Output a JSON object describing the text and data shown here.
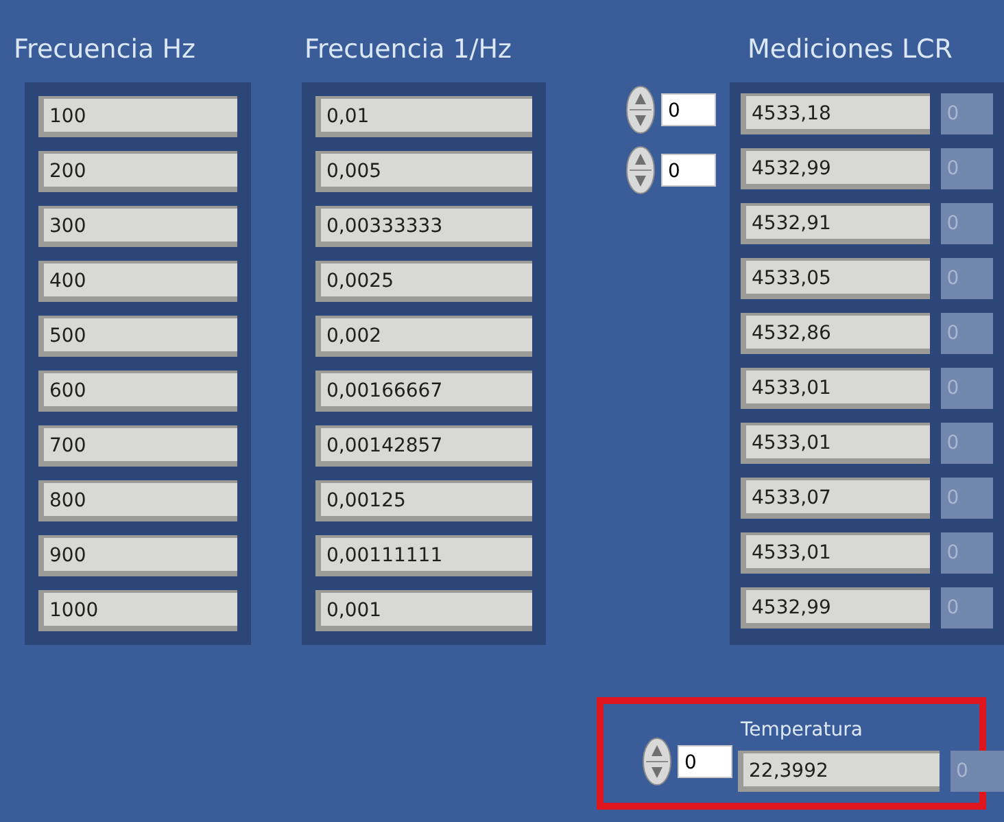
{
  "frecuencia_hz": {
    "title": "Frecuencia Hz",
    "values": [
      "100",
      "200",
      "300",
      "400",
      "500",
      "600",
      "700",
      "800",
      "900",
      "1000"
    ]
  },
  "frecuencia_inv": {
    "title": "Frecuencia 1/Hz",
    "values": [
      "0,01",
      "0,005",
      "0,00333333",
      "0,0025",
      "0,002",
      "0,00166667",
      "0,00142857",
      "0,00125",
      "0,00111111",
      "0,001"
    ]
  },
  "mediciones": {
    "title": "Mediciones LCR",
    "indices": [
      "0",
      "0"
    ],
    "rows": [
      {
        "value": "4533,18",
        "column_2": "0"
      },
      {
        "value": "4532,99",
        "column_2": "0"
      },
      {
        "value": "4532,91",
        "column_2": "0"
      },
      {
        "value": "4533,05",
        "column_2": "0"
      },
      {
        "value": "4532,86",
        "column_2": "0"
      },
      {
        "value": "4533,01",
        "column_2": "0"
      },
      {
        "value": "4533,01",
        "column_2": "0"
      },
      {
        "value": "4533,07",
        "column_2": "0"
      },
      {
        "value": "4533,01",
        "column_2": "0"
      },
      {
        "value": "4532,99",
        "column_2": "0"
      }
    ]
  },
  "temperatura": {
    "label": "Temperatura",
    "index": "0",
    "value": "22,3992",
    "column_2": "0",
    "highlighted": true
  }
}
